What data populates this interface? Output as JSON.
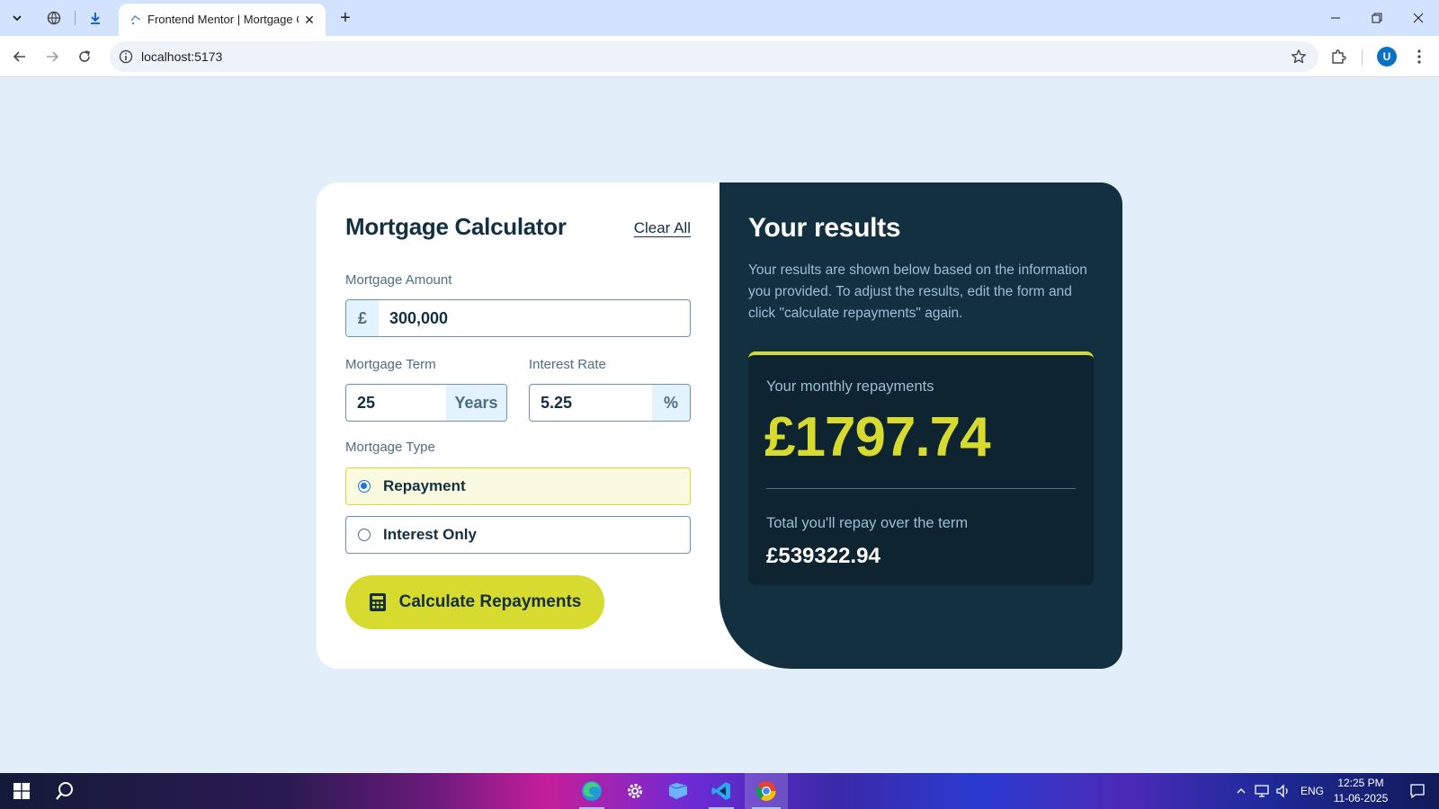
{
  "browser": {
    "tab_title": "Frontend Mentor | Mortgage Calculator",
    "url": "localhost:5173",
    "profile_initial": "U"
  },
  "calculator": {
    "title": "Mortgage Calculator",
    "clear_all": "Clear All",
    "amount": {
      "label": "Mortgage Amount",
      "prefix": "£",
      "value": "300,000"
    },
    "term": {
      "label": "Mortgage Term",
      "value": "25",
      "suffix": "Years"
    },
    "rate": {
      "label": "Interest Rate",
      "value": "5.25",
      "suffix": "%"
    },
    "type": {
      "label": "Mortgage Type",
      "options": [
        {
          "label": "Repayment",
          "selected": true
        },
        {
          "label": "Interest Only",
          "selected": false
        }
      ]
    },
    "submit_label": "Calculate Repayments"
  },
  "results": {
    "title": "Your results",
    "description": "Your results are shown below based on the information you provided. To adjust the results, edit the form and click \"calculate repayments\" again.",
    "monthly_label": "Your monthly repayments",
    "monthly_value": "£1797.74",
    "total_label": "Total you'll repay over the term",
    "total_value": "£539322.94"
  },
  "taskbar": {
    "language": "ENG",
    "time": "12:25 PM",
    "date": "11-06-2025"
  },
  "colors": {
    "lime": "#d7da2f",
    "slate_900": "#133041",
    "page_bg": "#e2effa"
  }
}
